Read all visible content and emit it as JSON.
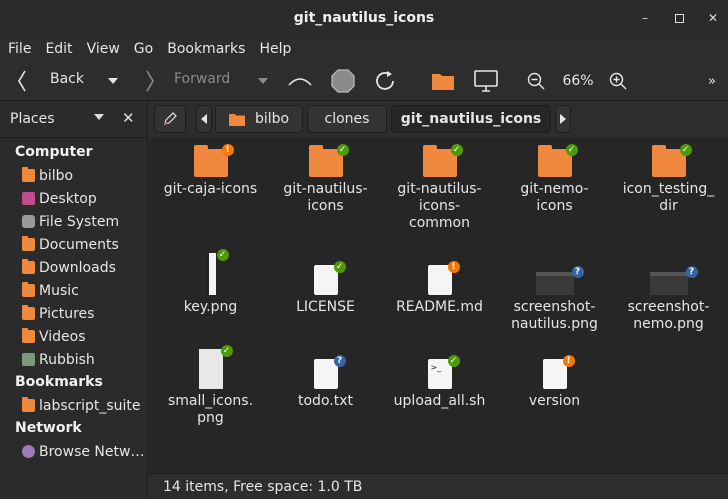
{
  "window": {
    "title": "git_nautilus_icons"
  },
  "menubar": [
    "File",
    "Edit",
    "View",
    "Go",
    "Bookmarks",
    "Help"
  ],
  "toolbar": {
    "back_label": "Back",
    "forward_label": "Forward",
    "zoom_label": "66%"
  },
  "sidebar": {
    "header": "Places",
    "sections": [
      {
        "title": "Computer",
        "items": [
          {
            "label": "bilbo",
            "icon": "home-folder-icon"
          },
          {
            "label": "Desktop",
            "icon": "desktop-icon"
          },
          {
            "label": "File System",
            "icon": "drive-icon"
          },
          {
            "label": "Documents",
            "icon": "folder-icon"
          },
          {
            "label": "Downloads",
            "icon": "folder-icon"
          },
          {
            "label": "Music",
            "icon": "folder-icon"
          },
          {
            "label": "Pictures",
            "icon": "folder-icon"
          },
          {
            "label": "Videos",
            "icon": "folder-icon"
          },
          {
            "label": "Rubbish",
            "icon": "trash-icon"
          }
        ]
      },
      {
        "title": "Bookmarks",
        "items": [
          {
            "label": "labscript_suite",
            "icon": "folder-icon"
          }
        ]
      },
      {
        "title": "Network",
        "items": [
          {
            "label": "Browse Netw…",
            "icon": "network-icon"
          }
        ]
      }
    ]
  },
  "pathbar": {
    "crumbs": [
      "bilbo",
      "clones",
      "git_nautilus_icons"
    ]
  },
  "files": [
    {
      "name": "git-caja-icons",
      "type": "folder",
      "emblem": "warn"
    },
    {
      "name": "git-nautilus-icons",
      "type": "folder",
      "emblem": "ok"
    },
    {
      "name": "git-nautilus-icons-common",
      "type": "folder",
      "emblem": "ok"
    },
    {
      "name": "git-nemo-icons",
      "type": "folder",
      "emblem": "ok"
    },
    {
      "name": "icon_testing_dir",
      "type": "folder",
      "emblem": "ok"
    },
    {
      "name": "key.png",
      "type": "image-strip",
      "emblem": "ok"
    },
    {
      "name": "LICENSE",
      "type": "doc",
      "emblem": "ok"
    },
    {
      "name": "README.md",
      "type": "doc",
      "emblem": "warn"
    },
    {
      "name": "screenshot-nautilus.png",
      "type": "screenshot",
      "emblem": "q"
    },
    {
      "name": "screenshot-nemo.png",
      "type": "screenshot",
      "emblem": "q"
    },
    {
      "name": "small_icons.png",
      "type": "image-list",
      "emblem": "ok"
    },
    {
      "name": "todo.txt",
      "type": "doc",
      "emblem": "q"
    },
    {
      "name": "upload_all.sh",
      "type": "script",
      "emblem": "ok"
    },
    {
      "name": "version",
      "type": "doc",
      "emblem": "warn"
    }
  ],
  "file_labels": {
    "f0": [
      "git-caja-icons"
    ],
    "f1": [
      "git-nautilus-",
      "icons"
    ],
    "f2": [
      "git-nautilus-",
      "icons-",
      "common"
    ],
    "f3": [
      "git-nemo-",
      "icons"
    ],
    "f4": [
      "icon_testing_",
      "dir"
    ],
    "f5": [
      "key.png"
    ],
    "f6": [
      "LICENSE"
    ],
    "f7": [
      "README.md"
    ],
    "f8": [
      "screenshot-",
      "nautilus.png"
    ],
    "f9": [
      "screenshot-",
      "nemo.png"
    ],
    "f10": [
      "small_icons.",
      "png"
    ],
    "f11": [
      "todo.txt"
    ],
    "f12": [
      "upload_all.sh"
    ],
    "f13": [
      "version"
    ]
  },
  "status": {
    "text": "14 items, Free space: 1.0 TB"
  },
  "colors": {
    "folder": "#f0883e",
    "emblem_ok": "#4e9a06",
    "emblem_warn": "#f57900",
    "emblem_question": "#3465a4"
  }
}
